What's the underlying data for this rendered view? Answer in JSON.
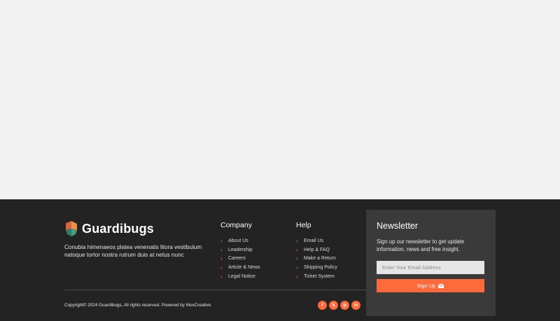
{
  "brand": {
    "name": "Guardibugs",
    "tagline": "Conubia himenaeos platea venenatis litora vestibulum natoque tortor nostra rutrum duis at netus nunc"
  },
  "company": {
    "title": "Company",
    "links": [
      "About Us",
      "Leadership",
      "Careers",
      "Article & News",
      "Legal Notice"
    ]
  },
  "help": {
    "title": "Help",
    "links": [
      "Email Us",
      "Help & FAQ",
      "Make a Return",
      "Shipping Policy",
      "Ticket System"
    ]
  },
  "newsletter": {
    "title": "Newsletter",
    "description": "Sign up our newsletter to get update information, news and free insight.",
    "email_placeholder": "Enter Your Email Address",
    "button_label": "Sign Up"
  },
  "footer": {
    "copyright": "Copyright© 2024 Guardibugs, All rights reserved. Powered by MoxCreative."
  },
  "socials": [
    {
      "icon": "facebook-icon",
      "glyph": "f"
    },
    {
      "icon": "x-twitter-icon",
      "glyph": "𝕏"
    },
    {
      "icon": "instagram-icon",
      "glyph": "◎"
    },
    {
      "icon": "linkedin-icon",
      "glyph": "in"
    }
  ],
  "colors": {
    "accent": "#ff6a3d",
    "footer_bg": "#232323",
    "newsletter_bg": "#3a3a3a",
    "page_bg": "#f2f2f2"
  }
}
